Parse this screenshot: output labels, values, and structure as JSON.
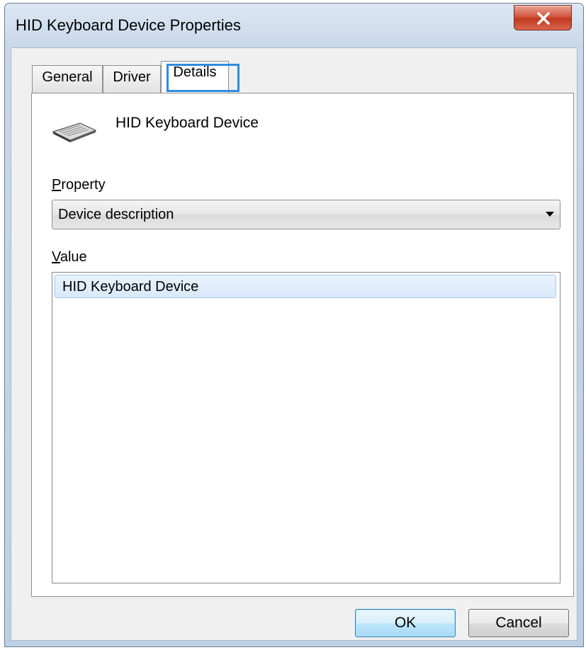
{
  "window": {
    "title": "HID Keyboard Device Properties",
    "close_symbol": "X"
  },
  "tabs": [
    {
      "label": "General",
      "selected": false
    },
    {
      "label": "Driver",
      "selected": false
    },
    {
      "label": "Details",
      "selected": true
    }
  ],
  "device": {
    "name": "HID Keyboard Device",
    "icon": "keyboard-icon"
  },
  "property": {
    "label_first": "P",
    "label_rest": "roperty",
    "selected": "Device description"
  },
  "value": {
    "label_first": "V",
    "label_rest": "alue",
    "items": [
      "HID Keyboard Device"
    ]
  },
  "buttons": {
    "ok": "OK",
    "cancel": "Cancel"
  },
  "colors": {
    "tab_highlight": "#2f8be0",
    "close_button": "#c0391f",
    "selection": "#d9e9fb"
  }
}
